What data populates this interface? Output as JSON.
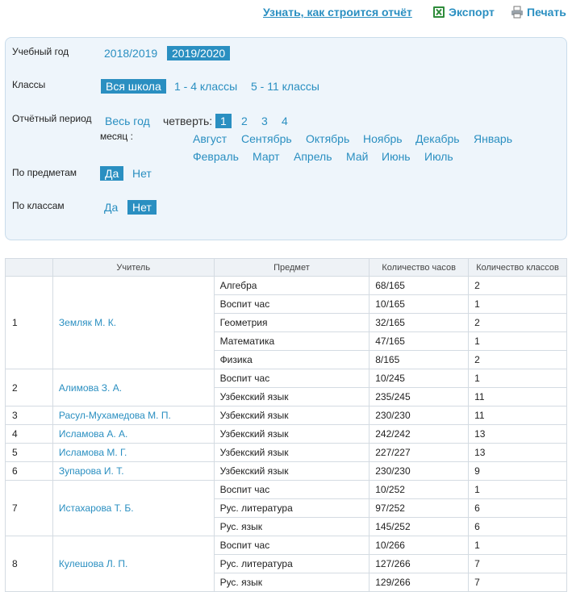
{
  "toolbar": {
    "how_link": "Узнать, как строится отчёт",
    "export_label": "Экспорт",
    "print_label": "Печать"
  },
  "filters": {
    "year": {
      "label": "Учебный год",
      "options": [
        "2018/2019",
        "2019/2020"
      ],
      "selected": "2019/2020"
    },
    "classes": {
      "label": "Классы",
      "options": [
        "Вся школа",
        "1 - 4 классы",
        "5 - 11 классы"
      ],
      "selected": "Вся школа"
    },
    "period": {
      "label": "Отчётный период",
      "whole_year": "Весь год",
      "quarter_label": "четверть:",
      "quarters": [
        "1",
        "2",
        "3",
        "4"
      ],
      "selected_quarter": "1",
      "month_label": "месяц :",
      "months_row1": [
        "Август",
        "Сентябрь",
        "Октябрь",
        "Ноябрь",
        "Декабрь",
        "Январь"
      ],
      "months_row2": [
        "Февраль",
        "Март",
        "Апрель",
        "Май",
        "Июнь",
        "Июль"
      ]
    },
    "by_subject": {
      "label": "По предметам",
      "yes": "Да",
      "no": "Нет",
      "selected": "Да"
    },
    "by_class": {
      "label": "По классам",
      "yes": "Да",
      "no": "Нет",
      "selected": "Нет"
    }
  },
  "table": {
    "headers": [
      "",
      "Учитель",
      "Предмет",
      "Количество часов",
      "Количество классов"
    ],
    "groups": [
      {
        "num": "1",
        "teacher": "Земляк М. К.",
        "rows": [
          {
            "subject": "Алгебра",
            "hours": "68/165",
            "classes": "2"
          },
          {
            "subject": "Воспит час",
            "hours": "10/165",
            "classes": "1"
          },
          {
            "subject": "Геометрия",
            "hours": "32/165",
            "classes": "2"
          },
          {
            "subject": "Математика",
            "hours": "47/165",
            "classes": "1"
          },
          {
            "subject": "Физика",
            "hours": "8/165",
            "classes": "2"
          }
        ]
      },
      {
        "num": "2",
        "teacher": "Алимова З. А.",
        "rows": [
          {
            "subject": "Воспит час",
            "hours": "10/245",
            "classes": "1"
          },
          {
            "subject": "Узбекский язык",
            "hours": "235/245",
            "classes": "11"
          }
        ]
      },
      {
        "num": "3",
        "teacher": "Расул-Мухамедова М. П.",
        "rows": [
          {
            "subject": "Узбекский язык",
            "hours": "230/230",
            "classes": "11"
          }
        ]
      },
      {
        "num": "4",
        "teacher": "Исламова А. А.",
        "rows": [
          {
            "subject": "Узбекский язык",
            "hours": "242/242",
            "classes": "13"
          }
        ]
      },
      {
        "num": "5",
        "teacher": "Исламова М. Г.",
        "rows": [
          {
            "subject": "Узбекский язык",
            "hours": "227/227",
            "classes": "13"
          }
        ]
      },
      {
        "num": "6",
        "teacher": "Зупарова И. Т.",
        "rows": [
          {
            "subject": "Узбекский язык",
            "hours": "230/230",
            "classes": "9"
          }
        ]
      },
      {
        "num": "7",
        "teacher": "Истахарова Т. Б.",
        "rows": [
          {
            "subject": "Воспит час",
            "hours": "10/252",
            "classes": "1"
          },
          {
            "subject": "Рус. литература",
            "hours": "97/252",
            "classes": "6"
          },
          {
            "subject": "Рус. язык",
            "hours": "145/252",
            "classes": "6"
          }
        ]
      },
      {
        "num": "8",
        "teacher": "Кулешова Л. П.",
        "rows": [
          {
            "subject": "Воспит час",
            "hours": "10/266",
            "classes": "1"
          },
          {
            "subject": "Рус. литература",
            "hours": "127/266",
            "classes": "7"
          },
          {
            "subject": "Рус. язык",
            "hours": "129/266",
            "classes": "7"
          }
        ]
      }
    ]
  },
  "icons": {
    "export": "excel-icon",
    "print": "printer-icon"
  },
  "colors": {
    "accent": "#2a8fc1",
    "panel_bg": "#eef5fb",
    "header_bg": "#eef2f6"
  }
}
